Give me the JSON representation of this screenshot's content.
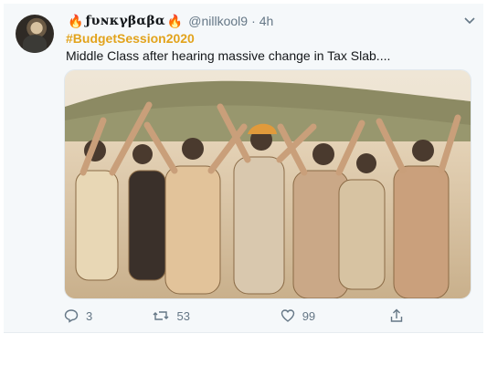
{
  "tweet": {
    "display_name": "ƒυɴκγβαβα",
    "handle": "@nillkool9",
    "separator": "·",
    "time": "4h",
    "hashtag": "#BudgetSession2020",
    "text": "Middle Class after hearing massive change in Tax Slab....",
    "counts": {
      "replies": "3",
      "retweets": "53",
      "likes": "99"
    }
  },
  "icons": {
    "flame_left": "fire-icon",
    "flame_right": "fire-icon",
    "menu": "chevron-down-icon",
    "reply": "reply-icon",
    "retweet": "retweet-icon",
    "like": "heart-icon",
    "share": "share-icon"
  },
  "colors": {
    "hashtag": "#e2a31c",
    "muted": "#657786",
    "text": "#14171a",
    "flame": "#f08a24"
  }
}
